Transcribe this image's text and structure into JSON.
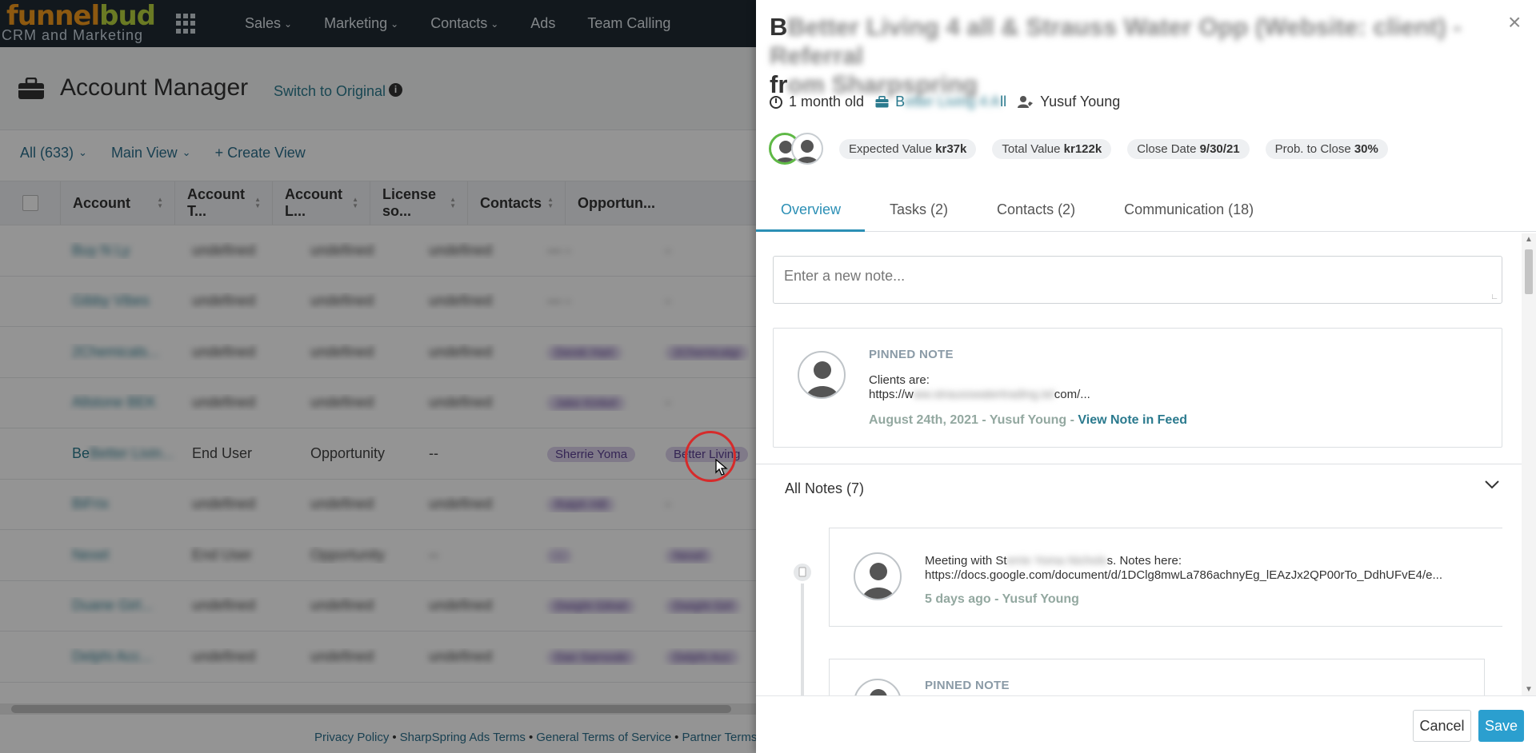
{
  "topnav": {
    "logo_main": "funnel",
    "logo_accent": "bud",
    "logo_sub": "CRM and Marketing",
    "items": [
      {
        "label": "Sales",
        "chevron": true
      },
      {
        "label": "Marketing",
        "chevron": true
      },
      {
        "label": "Contacts",
        "chevron": true
      },
      {
        "label": "Ads",
        "chevron": false
      },
      {
        "label": "Team Calling",
        "chevron": false
      }
    ]
  },
  "header": {
    "title": "Account Manager",
    "switch_link": "Switch to Original",
    "info": "i"
  },
  "viewbar": {
    "all_filter": "All (633)",
    "main_view": "Main View",
    "create_view": "+ Create View"
  },
  "table": {
    "columns": [
      "Account",
      "Account T...",
      "Account L...",
      "License so...",
      "Contacts",
      "Opportun..."
    ],
    "rows": [
      {
        "account": "Buy N Ly",
        "type": "undefined",
        "level": "undefined",
        "license": "undefined",
        "contacts": "--- -",
        "opps": "-",
        "blurred": true
      },
      {
        "account": "Gibby Vibes",
        "type": "undefined",
        "level": "undefined",
        "license": "undefined",
        "contacts": "--- -",
        "opps": "-",
        "blurred": true
      },
      {
        "account": "2Chemicals...",
        "type": "undefined",
        "level": "undefined",
        "license": "undefined",
        "contacts": "Derek Hart",
        "opps": "2Chemicalgi",
        "blurred": true
      },
      {
        "account": "Allstone BEK",
        "type": "undefined",
        "level": "undefined",
        "license": "undefined",
        "contacts": "Jake Kinkel",
        "opps": "-",
        "blurred": true
      },
      {
        "account_visible": "Be",
        "account": "Better Livin...",
        "type": "End User",
        "level": "Opportunity",
        "license": "--",
        "contacts": "Sherrie Yoma",
        "opps": "Better Living",
        "blurred": false
      },
      {
        "account": "BiFrix",
        "type": "undefined",
        "level": "undefined",
        "license": "undefined",
        "contacts": "Ralph Hill",
        "opps": "-",
        "blurred": true
      },
      {
        "account": "Nexel",
        "type": "End User",
        "level": "Opportunity",
        "license": "--",
        "contacts": "--",
        "opps": "Nexel",
        "blurred": true
      },
      {
        "account": "Duane Girl...",
        "type": "undefined",
        "level": "undefined",
        "license": "undefined",
        "contacts": "Dwight Gilnet",
        "opps": "Dwight Girl",
        "blurred": true
      },
      {
        "account": "Delphi Acc...",
        "type": "undefined",
        "level": "undefined",
        "license": "undefined",
        "contacts": "Dan Sarnoski",
        "opps": "Delphi Acc",
        "blurred": true
      }
    ]
  },
  "footer": {
    "links": [
      "Privacy Policy",
      "SharpSpring Ads Terms",
      "General Terms of Service",
      "Partner Terms"
    ],
    "separator": "•"
  },
  "panel": {
    "title_visible_start": "B",
    "title_blurred": "Better Living 4 all & Strauss Water Opp (Website: client) - Referral",
    "title_line2_visible": "fr",
    "title_line2_blurred": "om Sharpspring",
    "close": "×",
    "age": "1 month old",
    "account_visible": "B",
    "account_blurred": "etter Living 4 A",
    "account_tail": "ll",
    "owner": "Yusuf Young",
    "badges": [
      {
        "label": "Expected Value",
        "value": "kr37k"
      },
      {
        "label": "Total Value",
        "value": "kr122k"
      },
      {
        "label": "Close Date",
        "value": "9/30/21"
      },
      {
        "label": "Prob. to Close",
        "value": "30%"
      }
    ],
    "tabs": [
      "Overview",
      "Tasks (2)",
      "Contacts (2)",
      "Communication (18)"
    ],
    "active_tab": 0,
    "note_placeholder": "Enter a new note...",
    "pinned": {
      "label": "PINNED NOTE",
      "line1": "Clients are:",
      "line2_start": "https://w",
      "line2_blurred": "ww.strausswatertrading.tel",
      "line2_end": "com/...",
      "meta": "August 24th, 2021 - Yusuf Young - ",
      "view_link": "View Note in Feed"
    },
    "all_notes_label": "All Notes (7)",
    "notes": [
      {
        "line1_start": "Meeting with St",
        "line1_blurred": "errie Yoma Nichols",
        "line1_end": "s. Notes here:",
        "line2": "https://docs.google.com/document/d/1DClg8mwLa786achnyEg_lEAzJx2QP00rTo_DdhUFvE4/e...",
        "meta": "5 days ago - Yusuf Young"
      },
      {
        "label": "PINNED NOTE"
      }
    ],
    "cancel": "Cancel",
    "save": "Save"
  },
  "colors": {
    "nav_bg": "#1f2a33",
    "accent": "#2b8fb5",
    "save_bg": "#2b9fcf",
    "link": "#2b7a8e",
    "pill_bg": "#dcd3ec",
    "cursor_ring": "#d62b2b"
  }
}
